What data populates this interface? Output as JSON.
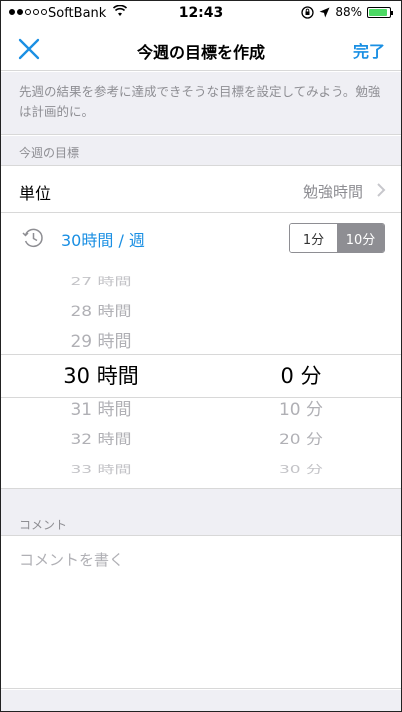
{
  "status_bar": {
    "carrier": "SoftBank",
    "time": "12:43",
    "battery_percent": "88%",
    "battery_level": 0.88
  },
  "nav": {
    "title": "今週の目標を作成",
    "done_label": "完了"
  },
  "description": "先週の結果を参考に達成できそうな目標を設定してみよう。勉強は計画的に。",
  "goal_section": {
    "header": "今週の目標",
    "unit_label": "単位",
    "unit_value": "勉強時間",
    "time_value": "30時間 / 週",
    "segments": [
      "1分",
      "10分"
    ],
    "active_segment": 1
  },
  "picker": {
    "hours": [
      "27 時間",
      "28 時間",
      "29 時間",
      "30 時間",
      "31 時間",
      "32 時間",
      "33 時間"
    ],
    "minutes": [
      "0 分",
      "10 分",
      "20 分",
      "30 分"
    ],
    "selected_hour_index": 3,
    "selected_minute_index": 0
  },
  "comment_section": {
    "header": "コメント",
    "placeholder": "コメントを書く",
    "value": ""
  },
  "colors": {
    "accent": "#1a8fe3",
    "grouped_background": "#efeff4",
    "secondary_text": "#8e8e93",
    "battery": "#4cd964"
  }
}
